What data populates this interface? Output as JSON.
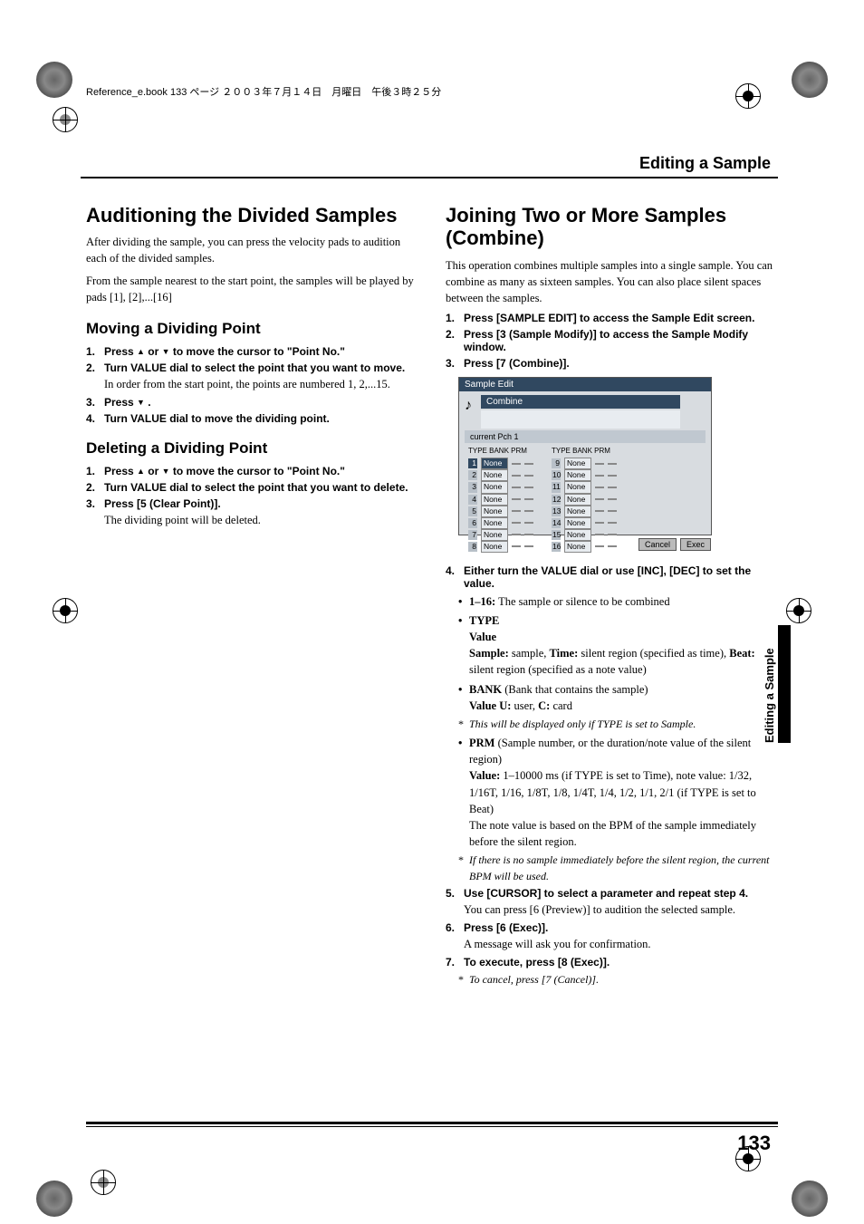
{
  "book_header": "Reference_e.book  133 ページ  ２００３年７月１４日　月曜日　午後３時２５分",
  "chapter_title": "Editing a Sample",
  "left": {
    "h1": "Auditioning the Divided Samples",
    "intro1": "After dividing the sample, you can press the velocity pads to audition each of the divided samples.",
    "intro2": "From the sample nearest to the start point, the samples will be played by pads [1], [2],...[16]",
    "h2a": "Moving a Dividing Point",
    "h2a_steps": [
      {
        "num": "1.",
        "bold_pre": "Press ",
        "bold_post": " to move the cursor to \"Point No.\"",
        "icons": "updown"
      },
      {
        "num": "2.",
        "bold": "Turn VALUE dial to select the point that you want to move.",
        "sub": "In order from the start point, the points are numbered 1, 2,...15."
      },
      {
        "num": "3.",
        "bold_pre": "Press ",
        "bold_post": " .",
        "icons": "down"
      },
      {
        "num": "4.",
        "bold": "Turn VALUE dial to move the dividing point."
      }
    ],
    "h2b": "Deleting a Dividing Point",
    "h2b_steps": [
      {
        "num": "1.",
        "bold_pre": "Press ",
        "bold_post": " to move the cursor to \"Point No.\"",
        "icons": "updown"
      },
      {
        "num": "2.",
        "bold": "Turn VALUE dial to select the point that you want to delete."
      },
      {
        "num": "3.",
        "bold": "Press [5 (Clear Point)].",
        "sub": "The dividing point will be deleted."
      }
    ]
  },
  "right": {
    "h1": "Joining Two or More Samples (Combine)",
    "intro": "This operation combines multiple samples into a single sample. You can combine as many as sixteen samples. You can also place silent spaces between the samples.",
    "steps_top": [
      {
        "num": "1.",
        "bold": "Press [SAMPLE EDIT] to access the Sample Edit screen."
      },
      {
        "num": "2.",
        "bold": "Press [3 (Sample Modify)] to access the Sample Modify window."
      },
      {
        "num": "3.",
        "bold": "Press [7 (Combine)]."
      }
    ],
    "screenshot": {
      "title": "Sample Edit",
      "combine": "Combine",
      "current": "current Pch 1",
      "col_header": "TYPE BANK PRM",
      "rows_left": [
        {
          "idx": "1",
          "type": "None"
        },
        {
          "idx": "2",
          "type": "None"
        },
        {
          "idx": "3",
          "type": "None"
        },
        {
          "idx": "4",
          "type": "None"
        },
        {
          "idx": "5",
          "type": "None"
        },
        {
          "idx": "6",
          "type": "None"
        },
        {
          "idx": "7",
          "type": "None"
        },
        {
          "idx": "8",
          "type": "None"
        }
      ],
      "rows_right": [
        {
          "idx": "9",
          "type": "None"
        },
        {
          "idx": "10",
          "type": "None"
        },
        {
          "idx": "11",
          "type": "None"
        },
        {
          "idx": "12",
          "type": "None"
        },
        {
          "idx": "13",
          "type": "None"
        },
        {
          "idx": "14",
          "type": "None"
        },
        {
          "idx": "15",
          "type": "None"
        },
        {
          "idx": "16",
          "type": "None"
        }
      ],
      "btn_cancel": "Cancel",
      "btn_exec": "Exec"
    },
    "step4": {
      "num": "4.",
      "bold": "Either turn the VALUE dial or use [INC], [DEC] to set the value."
    },
    "bullets": [
      {
        "label": "1–16:",
        "text": " The sample or silence to be combined"
      },
      {
        "label": "TYPE",
        "lines": [
          "Value",
          "Sample: sample, Time: silent region (specified as time), Beat: silent region (specified as a note value)"
        ]
      },
      {
        "label": "BANK",
        "after": " (Bank that contains the sample)",
        "lines": [
          "Value U: user, C: card"
        ]
      }
    ],
    "note1": "This will be displayed only if TYPE is set to Sample.",
    "prm": {
      "label": "PRM",
      "after": " (Sample number, or the duration/note value of the silent region)",
      "value_line": "Value: 1–10000 ms (if TYPE is set to Time), note value: 1/32, 1/16T, 1/16, 1/8T, 1/8, 1/4T, 1/4, 1/2, 1/1, 2/1 (if TYPE is set to Beat)",
      "text": "The note value is based on the BPM of the sample immediately before the silent region."
    },
    "note2": "If there is no sample immediately before the silent region, the current BPM will be used.",
    "step5": {
      "num": "5.",
      "bold": "Use [CURSOR] to select a parameter and repeat step 4.",
      "sub": "You can press [6 (Preview)] to audition the selected sample."
    },
    "step6": {
      "num": "6.",
      "bold": "Press [6 (Exec)].",
      "sub": "A message will ask you for confirmation."
    },
    "step7": {
      "num": "7.",
      "bold": "To execute, press [8 (Exec)]."
    },
    "note3": "To cancel, press [7 (Cancel)].",
    "side_tab": "Editing a Sample"
  },
  "page_number": "133"
}
